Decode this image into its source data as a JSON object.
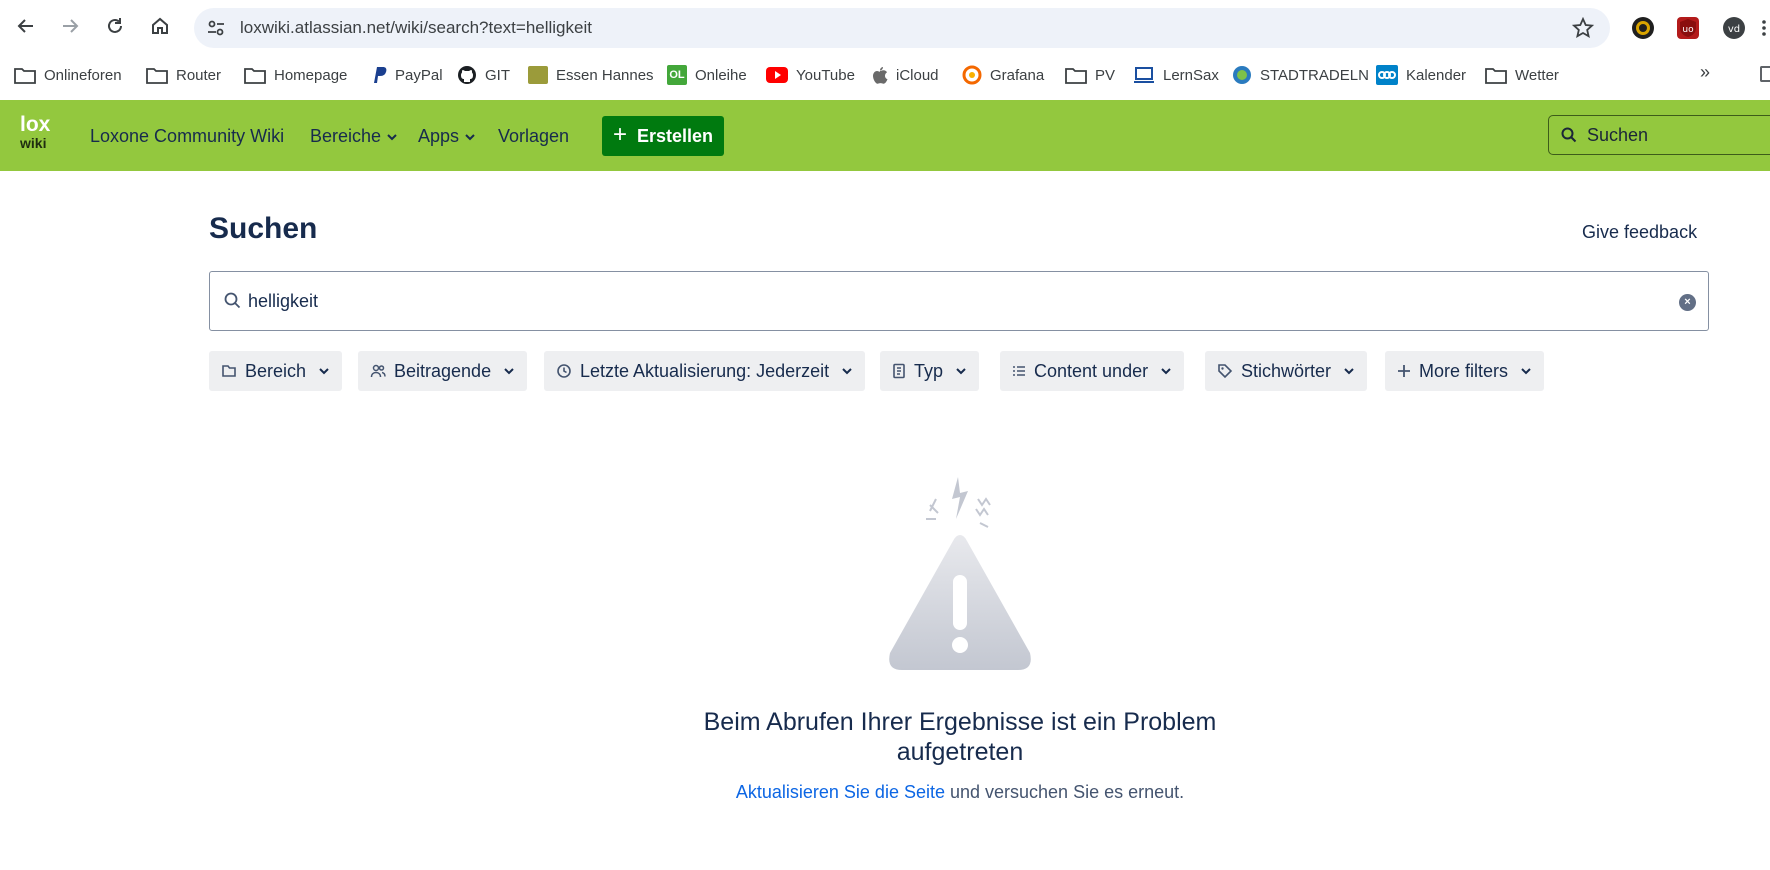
{
  "browser": {
    "url": "loxwiki.atlassian.net/wiki/search?text=helligkeit",
    "bookmarks": [
      {
        "label": "Onlineforen",
        "icon": "folder-icon"
      },
      {
        "label": "Router",
        "icon": "folder-icon"
      },
      {
        "label": "Homepage",
        "icon": "folder-icon"
      },
      {
        "label": "PayPal",
        "icon": "paypal-icon"
      },
      {
        "label": "GIT",
        "icon": "github-icon"
      },
      {
        "label": "Essen Hannes",
        "icon": "food-icon"
      },
      {
        "label": "Onleihe",
        "icon": "onleihe-icon"
      },
      {
        "label": "YouTube",
        "icon": "youtube-icon"
      },
      {
        "label": "iCloud",
        "icon": "apple-icon"
      },
      {
        "label": "Grafana",
        "icon": "grafana-icon"
      },
      {
        "label": "PV",
        "icon": "folder-icon"
      },
      {
        "label": "LernSax",
        "icon": "laptop-icon"
      },
      {
        "label": "STADTRADELN",
        "icon": "stadtradeln-icon"
      },
      {
        "label": "Kalender",
        "icon": "nextcloud-icon"
      },
      {
        "label": "Wetter",
        "icon": "folder-icon"
      }
    ],
    "overflow_label": "»"
  },
  "header": {
    "logo_line1": "lox",
    "logo_line2": "wiki",
    "site_name": "Loxone Community Wiki",
    "nav": {
      "spaces": "Bereiche",
      "apps": "Apps",
      "templates": "Vorlagen"
    },
    "create_label": "Erstellen",
    "search_placeholder": "Suchen"
  },
  "main": {
    "title": "Suchen",
    "feedback": "Give feedback",
    "search_value": "helligkeit",
    "filters": [
      {
        "label": "Bereich",
        "icon": "space-icon"
      },
      {
        "label": "Beitragende",
        "icon": "people-icon"
      },
      {
        "label": "Letzte Aktualisierung: Jederzeit",
        "icon": "clock-icon"
      },
      {
        "label": "Typ",
        "icon": "document-icon"
      },
      {
        "label": "Content under",
        "icon": "list-icon"
      },
      {
        "label": "Stichwörter",
        "icon": "tag-icon"
      },
      {
        "label": "More filters",
        "icon": "plus-icon"
      }
    ],
    "error": {
      "title": "Beim Abrufen Ihrer Ergebnisse ist ein Problem aufgetreten",
      "link": "Aktualisieren Sie die Seite",
      "rest": " und versuchen Sie es erneut."
    }
  },
  "colors": {
    "header_bg": "#93c83e",
    "create_btn": "#007a0f",
    "link": "#0c66e4",
    "filter_bg": "#eeeff1"
  }
}
